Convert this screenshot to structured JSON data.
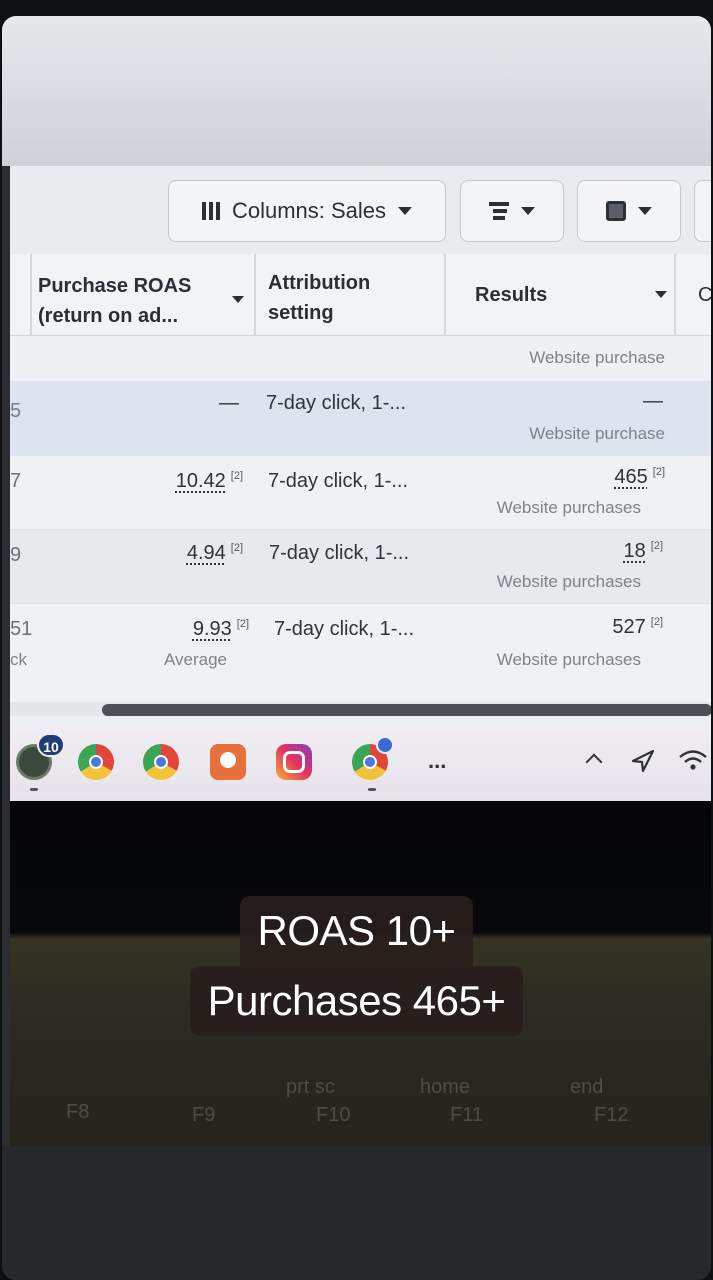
{
  "toolbar": {
    "columns_label": "Columns: Sales"
  },
  "table": {
    "headers": {
      "roas_line1": "Purchase ROAS",
      "roas_line2": "(return on ad...",
      "attribution_line1": "Attribution",
      "attribution_line2": "setting",
      "results": "Results",
      "edge": "C"
    },
    "rows": [
      {
        "edge": "",
        "roas": "",
        "roas_sup": "",
        "attribution": "",
        "results": "",
        "results_sup": "",
        "results_sub": "Website purchase"
      },
      {
        "edge": "5",
        "roas": "—",
        "roas_sup": "",
        "attribution": "7-day click, 1-...",
        "results": "—",
        "results_sup": "",
        "results_sub": "Website purchase"
      },
      {
        "edge": "7",
        "roas": "10.42",
        "roas_sup": "[2]",
        "attribution": "7-day click, 1-...",
        "results": "465",
        "results_sup": "[2]",
        "results_sub": "Website purchases"
      },
      {
        "edge": "9",
        "roas": "4.94",
        "roas_sup": "[2]",
        "attribution": "7-day click, 1-...",
        "results": "18",
        "results_sup": "[2]",
        "results_sub": "Website purchases"
      },
      {
        "edge": "51",
        "edge_sub": "ck",
        "roas": "9.93",
        "roas_sup": "[2]",
        "roas_sub": "Average",
        "attribution": "7-day click, 1-...",
        "results": "527",
        "results_sup": "[2]",
        "results_sub": "Website purchases"
      }
    ]
  },
  "taskbar": {
    "whatsapp_badge": "10",
    "more_label": "..."
  },
  "keyboard": {
    "keys": [
      "prt sc",
      "home",
      "end",
      "F8",
      "F9",
      "F10",
      "F11",
      "F12"
    ]
  },
  "caption": {
    "line1": "ROAS 10+",
    "line2": "Purchases 465+"
  },
  "colors": {
    "row_highlight": "#dde3ef",
    "caption_bg": "#281e1c"
  }
}
